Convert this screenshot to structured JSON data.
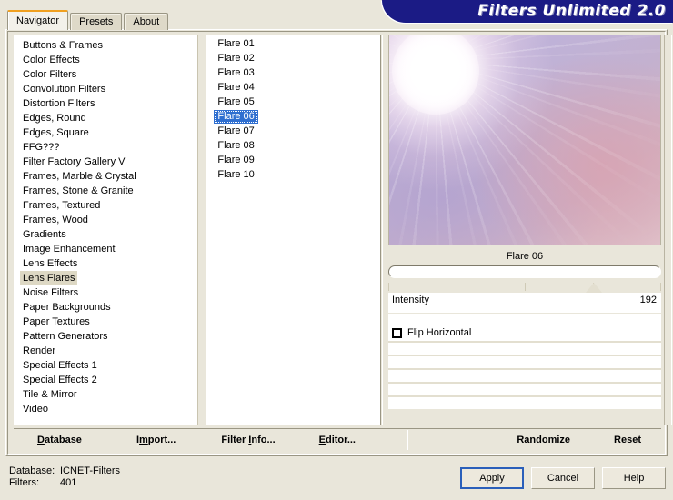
{
  "app": {
    "title": "Filters Unlimited 2.0"
  },
  "tabs": [
    {
      "label": "Navigator",
      "active": true
    },
    {
      "label": "Presets",
      "active": false
    },
    {
      "label": "About",
      "active": false
    }
  ],
  "categories": {
    "selected": "Lens Flares",
    "items": [
      "Buttons & Frames",
      "Color Effects",
      "Color Filters",
      "Convolution Filters",
      "Distortion Filters",
      "Edges, Round",
      "Edges, Square",
      "FFG???",
      "Filter Factory Gallery V",
      "Frames, Marble & Crystal",
      "Frames, Stone & Granite",
      "Frames, Textured",
      "Frames, Wood",
      "Gradients",
      "Image Enhancement",
      "Lens Effects",
      "Lens Flares",
      "Noise Filters",
      "Paper Backgrounds",
      "Paper Textures",
      "Pattern Generators",
      "Render",
      "Special Effects 1",
      "Special Effects 2",
      "Tile & Mirror",
      "Video"
    ]
  },
  "presets": {
    "selected": "Flare 06",
    "items": [
      "Flare 01",
      "Flare 02",
      "Flare 03",
      "Flare 04",
      "Flare 05",
      "Flare 06",
      "Flare 07",
      "Flare 08",
      "Flare 09",
      "Flare 10"
    ]
  },
  "preview": {
    "name": "preview-image"
  },
  "controls": {
    "title": "Flare 06",
    "name_field_value": "",
    "slider": {
      "label": "Intensity",
      "value": "192",
      "value_num": 192,
      "min": 0,
      "max": 255,
      "percent": 75.3
    },
    "checkbox": {
      "label": "Flip Horizontal",
      "checked": false
    }
  },
  "menubar": {
    "items": [
      {
        "prefix": "",
        "accel": "D",
        "suffix": "atabase"
      },
      {
        "prefix": "I",
        "accel": "m",
        "suffix": "port..."
      },
      {
        "prefix": "Filter ",
        "accel": "I",
        "suffix": "nfo..."
      },
      {
        "prefix": "",
        "accel": "E",
        "suffix": "ditor..."
      }
    ],
    "right": [
      {
        "label": "Randomize"
      },
      {
        "label": "Reset"
      }
    ]
  },
  "status": {
    "database_key": "Database:",
    "database_value": "ICNET-Filters",
    "filters_key": "Filters:",
    "filters_value": "401"
  },
  "dialog_buttons": [
    {
      "label": "Apply",
      "default": true
    },
    {
      "label": "Cancel",
      "default": false
    },
    {
      "label": "Help",
      "default": false
    }
  ],
  "colors": {
    "banner": "#1b1b85",
    "face": "#e9e6da",
    "selection_blue": "#2f6fd0",
    "selection_beige": "#ddd8c4",
    "tab_accent": "#f0a020"
  }
}
